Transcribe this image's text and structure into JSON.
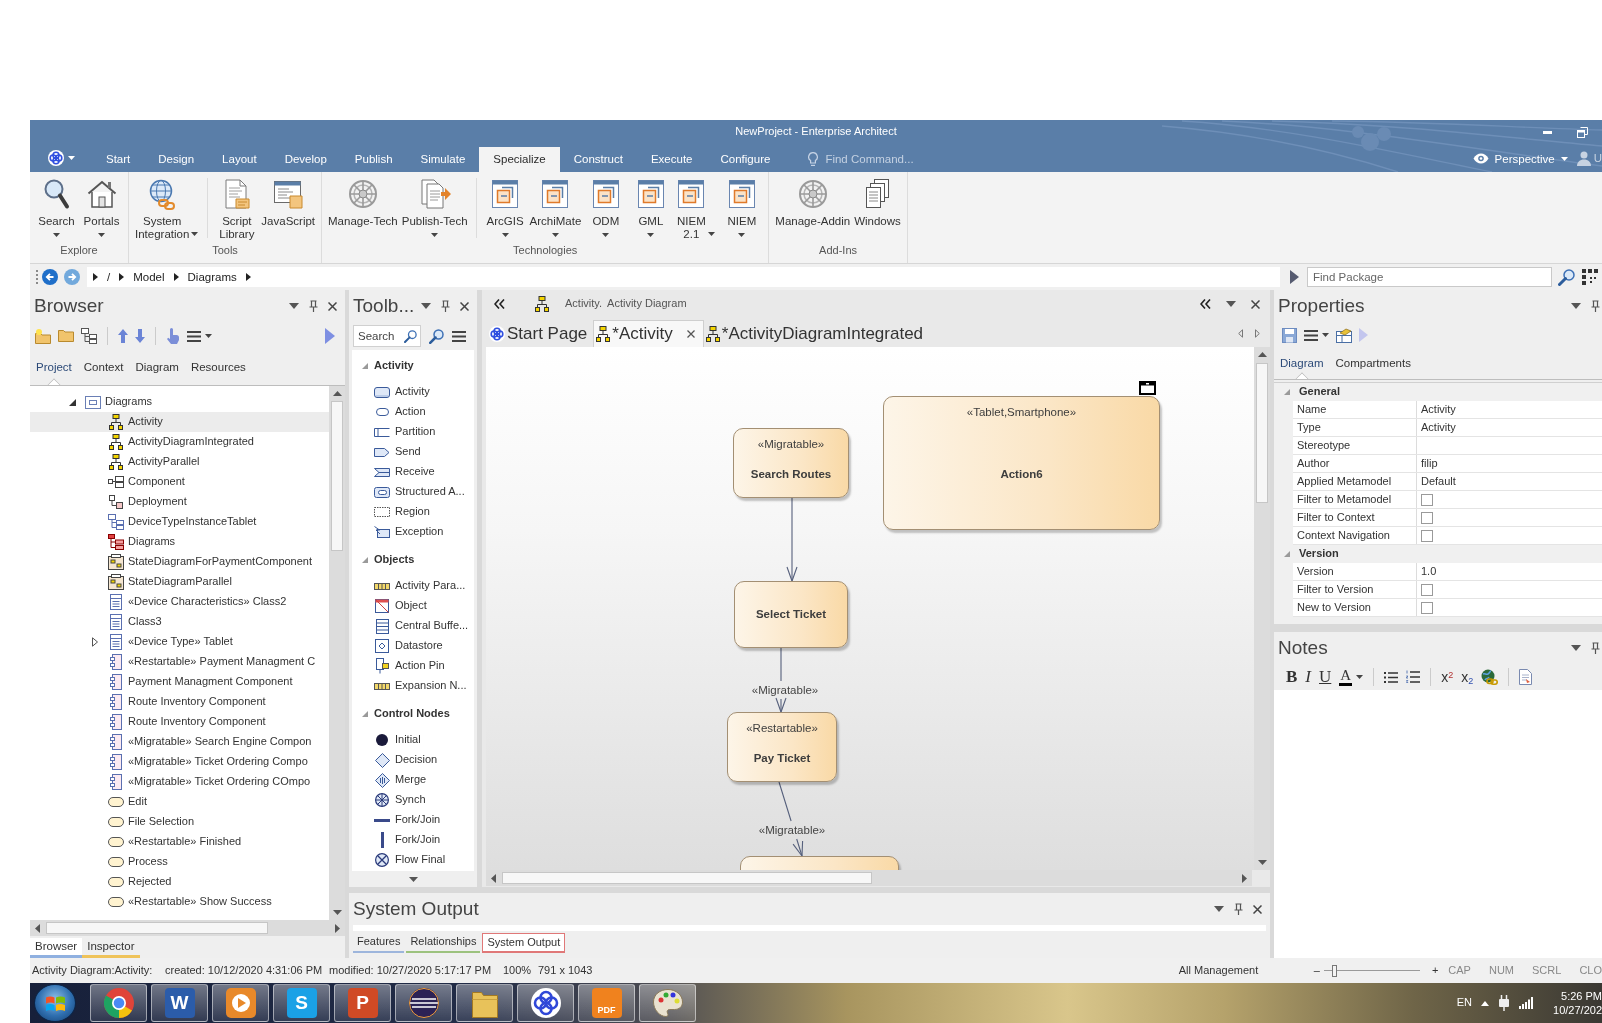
{
  "window": {
    "title": "NewProject - Enterprise Architect"
  },
  "ribbon": {
    "tabs": [
      {
        "label": "Start",
        "selected": false
      },
      {
        "label": "Design",
        "selected": false
      },
      {
        "label": "Layout",
        "selected": false
      },
      {
        "label": "Develop",
        "selected": false
      },
      {
        "label": "Publish",
        "selected": false
      },
      {
        "label": "Simulate",
        "selected": false
      },
      {
        "label": "Specialize",
        "selected": true
      },
      {
        "label": "Construct",
        "selected": false
      },
      {
        "label": "Execute",
        "selected": false
      },
      {
        "label": "Configure",
        "selected": false
      }
    ],
    "find_command": {
      "placeholder": "Find Command..."
    },
    "perspective": "Perspective",
    "user": "U",
    "groups": [
      {
        "label": "Explore",
        "sets": [
          [
            {
              "label": "Search",
              "kind": "magnifier",
              "dropdown": true
            },
            {
              "label": "Portals",
              "kind": "house",
              "dropdown": true
            }
          ]
        ]
      },
      {
        "label": "Tools",
        "sets": [
          [
            {
              "label": "System Integration",
              "kind": "globe",
              "dropdown": true
            }
          ],
          [
            {
              "label": "Script Library",
              "kind": "script",
              "dropdown": false
            },
            {
              "label": "JavaScript",
              "kind": "code",
              "dropdown": false
            }
          ]
        ]
      },
      {
        "label": "Technologies",
        "sets": [
          [
            {
              "label": "Manage-Tech",
              "kind": "wheel",
              "dropdown": false
            },
            {
              "label": "Publish-Tech",
              "kind": "export",
              "dropdown": true
            }
          ],
          [
            {
              "label": "ArcGIS",
              "kind": "module",
              "dropdown": true
            },
            {
              "label": "ArchiMate",
              "kind": "module",
              "dropdown": true
            },
            {
              "label": "ODM",
              "kind": "module",
              "dropdown": true
            },
            {
              "label": "GML",
              "kind": "module",
              "dropdown": true
            },
            {
              "label": "NIEM 2.1",
              "kind": "module",
              "dropdown": true
            },
            {
              "label": "NIEM",
              "kind": "module",
              "dropdown": true
            }
          ]
        ]
      },
      {
        "label": "Add-Ins",
        "sets": [
          [
            {
              "label": "Manage-Addin",
              "kind": "wheel",
              "dropdown": false
            },
            {
              "label": "Windows",
              "kind": "windows",
              "dropdown": false
            }
          ]
        ]
      }
    ]
  },
  "breadcrumb": {
    "path": [
      "/",
      "Model",
      "Diagrams"
    ]
  },
  "find_package": {
    "placeholder": "Find Package"
  },
  "browser": {
    "title": "Browser",
    "tabs": [
      {
        "label": "Project",
        "selected": true
      },
      {
        "label": "Context",
        "selected": false
      },
      {
        "label": "Diagram",
        "selected": false
      },
      {
        "label": "Resources",
        "selected": false
      }
    ],
    "tree": [
      {
        "label": "Diagrams",
        "kind": "package",
        "expanded": true,
        "selected": false,
        "children": [
          {
            "label": "Activity",
            "kind": "activity-diagram",
            "selected": true
          },
          {
            "label": "ActivityDiagramIntegrated",
            "kind": "activity-diagram",
            "selected": false
          },
          {
            "label": "ActivityParallel",
            "kind": "activity-diagram",
            "selected": false
          },
          {
            "label": "Component",
            "kind": "component-diagram",
            "selected": false
          },
          {
            "label": "Deployment",
            "kind": "deployment-diagram",
            "selected": false
          },
          {
            "label": "DeviceTypeInstanceTablet",
            "kind": "object-diagram",
            "selected": false
          },
          {
            "label": "Diagrams",
            "kind": "package-diagram",
            "selected": false
          },
          {
            "label": "StateDiagramForPaymentComponent",
            "kind": "state-diagram",
            "selected": false
          },
          {
            "label": "StateDiagramParallel",
            "kind": "state-diagram",
            "selected": false
          },
          {
            "label": "«Device Characteristics» Class2",
            "kind": "class",
            "selected": false
          },
          {
            "label": "Class3",
            "kind": "class",
            "selected": false
          },
          {
            "label": "«Device Type» Tablet",
            "kind": "class",
            "expanded": false,
            "selected": false
          },
          {
            "label": "«Restartable» Payment Managment C",
            "kind": "component",
            "selected": false
          },
          {
            "label": "Payment Managment Component",
            "kind": "component",
            "selected": false
          },
          {
            "label": "Route Inventory Component",
            "kind": "component",
            "selected": false
          },
          {
            "label": "Route Inventory Component",
            "kind": "component",
            "selected": false
          },
          {
            "label": "«Migratable» Search Engine Compon",
            "kind": "component",
            "selected": false
          },
          {
            "label": "«Migratable» Ticket Ordering Compo",
            "kind": "component",
            "selected": false
          },
          {
            "label": "«Migratable» Ticket Ordering COmpo",
            "kind": "component",
            "selected": false
          },
          {
            "label": "Edit",
            "kind": "action",
            "selected": false
          },
          {
            "label": "File Selection",
            "kind": "action",
            "selected": false
          },
          {
            "label": "«Restartable» Finished",
            "kind": "action",
            "selected": false
          },
          {
            "label": "Process",
            "kind": "action",
            "selected": false
          },
          {
            "label": "Rejected",
            "kind": "action",
            "selected": false
          },
          {
            "label": "«Restartable» Show Success",
            "kind": "action",
            "selected": false
          }
        ]
      }
    ],
    "bottom_tabs": [
      {
        "label": "Browser",
        "selected": true,
        "color": "#8fb0e0"
      },
      {
        "label": "Inspector",
        "selected": false,
        "color": "#efc35a"
      }
    ]
  },
  "toolbox": {
    "title": "Toolb...",
    "search": {
      "placeholder": "Search"
    },
    "groups": [
      {
        "label": "Activity",
        "expanded": true,
        "items": [
          {
            "label": "Activity",
            "kind": "activity"
          },
          {
            "label": "Action",
            "kind": "action"
          },
          {
            "label": "Partition",
            "kind": "partition"
          },
          {
            "label": "Send",
            "kind": "send"
          },
          {
            "label": "Receive",
            "kind": "receive"
          },
          {
            "label": "Structured A...",
            "kind": "structured"
          },
          {
            "label": "Region",
            "kind": "region"
          },
          {
            "label": "Exception",
            "kind": "exception"
          }
        ]
      },
      {
        "label": "Objects",
        "expanded": true,
        "items": [
          {
            "label": "Activity Para...",
            "kind": "parameter"
          },
          {
            "label": "Object",
            "kind": "object"
          },
          {
            "label": "Central Buffe...",
            "kind": "buffer"
          },
          {
            "label": "Datastore",
            "kind": "datastore"
          },
          {
            "label": "Action Pin",
            "kind": "pin"
          },
          {
            "label": "Expansion N...",
            "kind": "expansion"
          }
        ]
      },
      {
        "label": "Control Nodes",
        "expanded": true,
        "items": [
          {
            "label": "Initial",
            "kind": "initial"
          },
          {
            "label": "Decision",
            "kind": "decision"
          },
          {
            "label": "Merge",
            "kind": "merge"
          },
          {
            "label": "Synch",
            "kind": "synch"
          },
          {
            "label": "Fork/Join",
            "kind": "fork-h"
          },
          {
            "label": "Fork/Join",
            "kind": "fork-v"
          },
          {
            "label": "Flow Final",
            "kind": "flow-final"
          }
        ]
      }
    ]
  },
  "diagram": {
    "caption": "Activity.",
    "subtitle": "Activity Diagram",
    "tabs": [
      {
        "label": "Start Page",
        "kind": "start",
        "selected": false
      },
      {
        "label": "*Activity",
        "kind": "diagram",
        "selected": true
      },
      {
        "label": "*ActivityDiagramIntegrated",
        "kind": "diagram",
        "selected": false
      }
    ],
    "nodes": [
      {
        "kind": "action",
        "stereotype": "«Migratable»",
        "name": "Search Routes"
      },
      {
        "kind": "composite",
        "stereotype": "«Tablet,Smartphone»",
        "name": "Action6"
      },
      {
        "kind": "action",
        "name": "Select Ticket"
      },
      {
        "kind": "action",
        "stereotype": "«Restartable»",
        "name": "Pay Ticket"
      },
      {
        "kind": "action"
      }
    ],
    "edges": [
      {
        "kind": "flow"
      },
      {
        "kind": "flow",
        "stereotype": "«Migratable»"
      },
      {
        "kind": "flow",
        "stereotype": "«Migratable»"
      }
    ]
  },
  "output": {
    "title": "System Output",
    "tabs": [
      {
        "label": "Features",
        "color": "#9db5dc",
        "selected": false
      },
      {
        "label": "Relationships",
        "color": "#9cc27e",
        "selected": false
      },
      {
        "label": "System Output",
        "color": "#e07878",
        "selected": true
      }
    ]
  },
  "properties": {
    "title": "Properties",
    "tabs": [
      {
        "label": "Diagram",
        "selected": true
      },
      {
        "label": "Compartments",
        "selected": false
      }
    ],
    "sections": [
      {
        "label": "General",
        "expanded": true,
        "rows": [
          {
            "label": "Name",
            "kind": "text",
            "value": "Activity"
          },
          {
            "label": "Type",
            "kind": "text",
            "value": "Activity"
          },
          {
            "label": "Stereotype",
            "kind": "text"
          },
          {
            "label": "Author",
            "kind": "text",
            "value": "filip"
          },
          {
            "label": "Applied Metamodel",
            "kind": "text",
            "value": "Default"
          },
          {
            "label": "Filter to Metamodel",
            "kind": "checkbox",
            "checked": false
          },
          {
            "label": "Filter to Context",
            "kind": "checkbox",
            "checked": false
          },
          {
            "label": "Context Navigation",
            "kind": "checkbox",
            "checked": false
          }
        ]
      },
      {
        "label": "Version",
        "expanded": true,
        "rows": [
          {
            "label": "Version",
            "kind": "text",
            "value": "1.0"
          },
          {
            "label": "Filter to Version",
            "kind": "checkbox",
            "checked": false
          },
          {
            "label": "New to Version",
            "kind": "checkbox",
            "checked": false
          }
        ]
      }
    ]
  },
  "notes": {
    "title": "Notes",
    "format_sets": [
      [
        {
          "label": "B",
          "kind": "bold"
        },
        {
          "label": "I",
          "kind": "italic"
        },
        {
          "label": "U",
          "kind": "underline"
        },
        {
          "label": "A",
          "kind": "color"
        }
      ],
      [
        {
          "kind": "bullets"
        },
        {
          "kind": "numbers"
        }
      ],
      [
        {
          "label": "x$^{2}$",
          "kind": "superscript"
        },
        {
          "label": "x$_{2}$",
          "kind": "subscript"
        },
        {
          "kind": "link"
        }
      ],
      [
        {
          "kind": "document"
        }
      ]
    ]
  },
  "status_bar": {
    "context": "Activity Diagram:Activity:",
    "created": "created: 10/12/2020 4:31:06 PM",
    "modified": "modified: 10/27/2020 5:17:17 PM",
    "zoom": "100%",
    "size": "791 x 1043",
    "perspective": "All Management",
    "zoom_out": "–",
    "zoom_slider": {
      "level": 0.1
    },
    "zoom_in": "+",
    "indicators": [
      "CAP",
      "NUM",
      "SCRL",
      "CLO"
    ]
  },
  "taskbar": {
    "apps": [
      {
        "kind": "ring"
      },
      {
        "kind": "letter",
        "glyph": "W",
        "color": "#2b5caa"
      },
      {
        "kind": "play"
      },
      {
        "kind": "letter",
        "glyph": "S",
        "color": "#1aa1e6"
      },
      {
        "kind": "letter",
        "glyph": "P",
        "color": "#d04a25"
      },
      {
        "kind": "stripes"
      },
      {
        "kind": "folder"
      },
      {
        "kind": "knot"
      },
      {
        "kind": "letter",
        "glyph": "PDF",
        "color": "#f0821e"
      },
      {
        "kind": "palette"
      }
    ],
    "language": "EN",
    "time": "5:26 PM",
    "date": "10/27/202"
  }
}
